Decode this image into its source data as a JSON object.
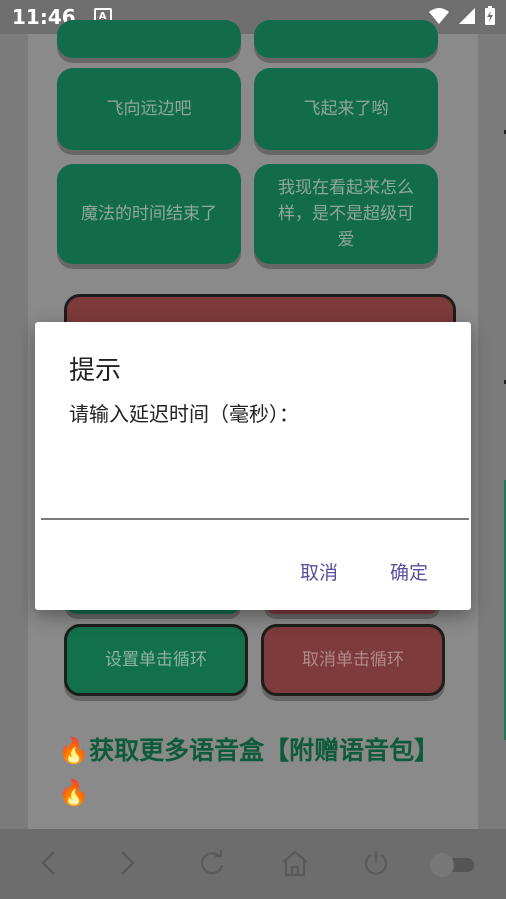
{
  "status_bar": {
    "time": "11:46",
    "notification_icon": "A"
  },
  "app": {
    "buttons": [
      {
        "label": "飞向远边吧"
      },
      {
        "label": "飞起来了哟"
      },
      {
        "label": "魔法的时间结束了"
      },
      {
        "label": "我现在看起来怎么样，是不是超级可爱"
      },
      {
        "label": "设置单击循环"
      },
      {
        "label": "取消单击循环"
      }
    ],
    "promo": "🔥获取更多语音盒【附赠语音包】🔥"
  },
  "dialog": {
    "title": "提示",
    "message": "请输入延迟时间（毫秒）：",
    "input_value": "",
    "cancel_label": "取消",
    "ok_label": "确定"
  },
  "colors": {
    "green_button": "#126c4b",
    "red_button": "#7c3a3a",
    "dialog_accent": "#5b4e9c",
    "promo_text": "#0e5a3c"
  }
}
